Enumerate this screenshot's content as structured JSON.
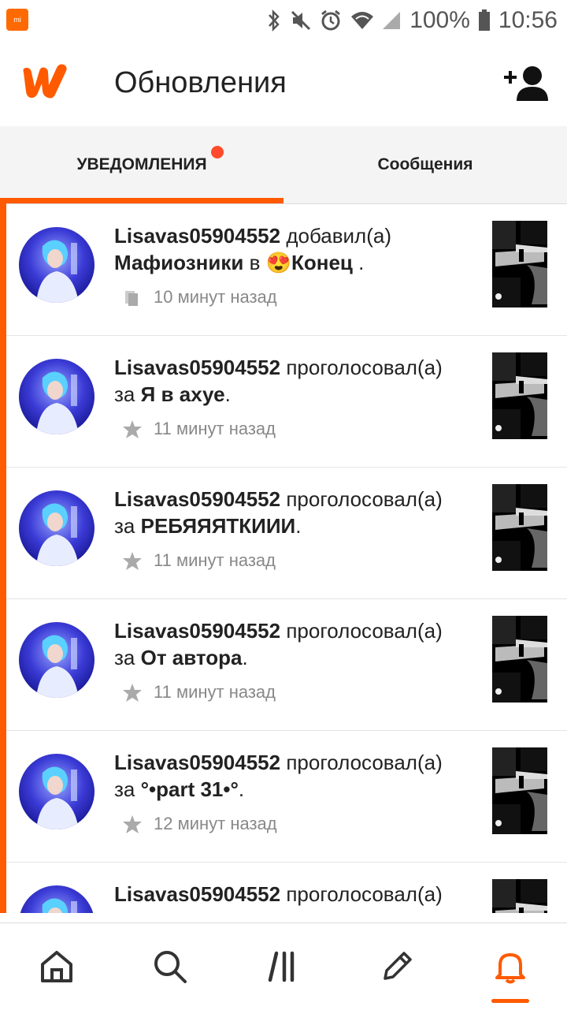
{
  "status_bar": {
    "badge_text": "mi",
    "battery": "100%",
    "time": "10:56",
    "icons": [
      "bluetooth-icon",
      "mute-icon",
      "alarm-icon",
      "wifi-icon",
      "signal-icon",
      "battery-icon"
    ]
  },
  "header": {
    "title": "Обновления",
    "logo_icon": "wattpad-logo",
    "action_icon": "add-user-icon"
  },
  "tabs": [
    {
      "label": "УВЕДОМЛЕНИЯ",
      "active": true,
      "has_dot": true
    },
    {
      "label": "Сообщения",
      "active": false
    }
  ],
  "notifications": [
    {
      "user": "Lisavas05904552",
      "action": "добавил(а)",
      "object": "Мафиозники",
      "connector": "в",
      "target": "Конец",
      "emoji": "😍",
      "end": " .",
      "meta_icon": "library-icon",
      "time": "10 минут назад"
    },
    {
      "user": "Lisavas05904552",
      "action": "проголосовал(а)",
      "connector": "за",
      "target": "Я в ахуе",
      "end": ".",
      "meta_icon": "star-icon",
      "time": "11 минут назад"
    },
    {
      "user": "Lisavas05904552",
      "action": "проголосовал(а)",
      "connector": "за",
      "target": "РЕБЯЯЯТКИИИ",
      "end": ".",
      "meta_icon": "star-icon",
      "time": "11 минут назад"
    },
    {
      "user": "Lisavas05904552",
      "action": "проголосовал(а)",
      "connector": "за",
      "target": "От автора",
      "end": ".",
      "meta_icon": "star-icon",
      "time": "11 минут назад"
    },
    {
      "user": "Lisavas05904552",
      "action": "проголосовал(а)",
      "connector": "за",
      "target": "°•part 31•°",
      "end": ".",
      "meta_icon": "star-icon",
      "time": "12 минут назад"
    },
    {
      "user": "Lisavas05904552",
      "action": "проголосовал(а)",
      "connector": "",
      "target": "",
      "end": "",
      "meta_icon": "star-icon",
      "time": ""
    }
  ],
  "bottom_nav": [
    {
      "icon": "home-icon",
      "active": false
    },
    {
      "icon": "search-icon",
      "active": false
    },
    {
      "icon": "library-icon",
      "active": false
    },
    {
      "icon": "write-icon",
      "active": false
    },
    {
      "icon": "bell-icon",
      "active": true
    }
  ],
  "colors": {
    "accent": "#ff5a00",
    "dot": "#ff4b2b"
  }
}
